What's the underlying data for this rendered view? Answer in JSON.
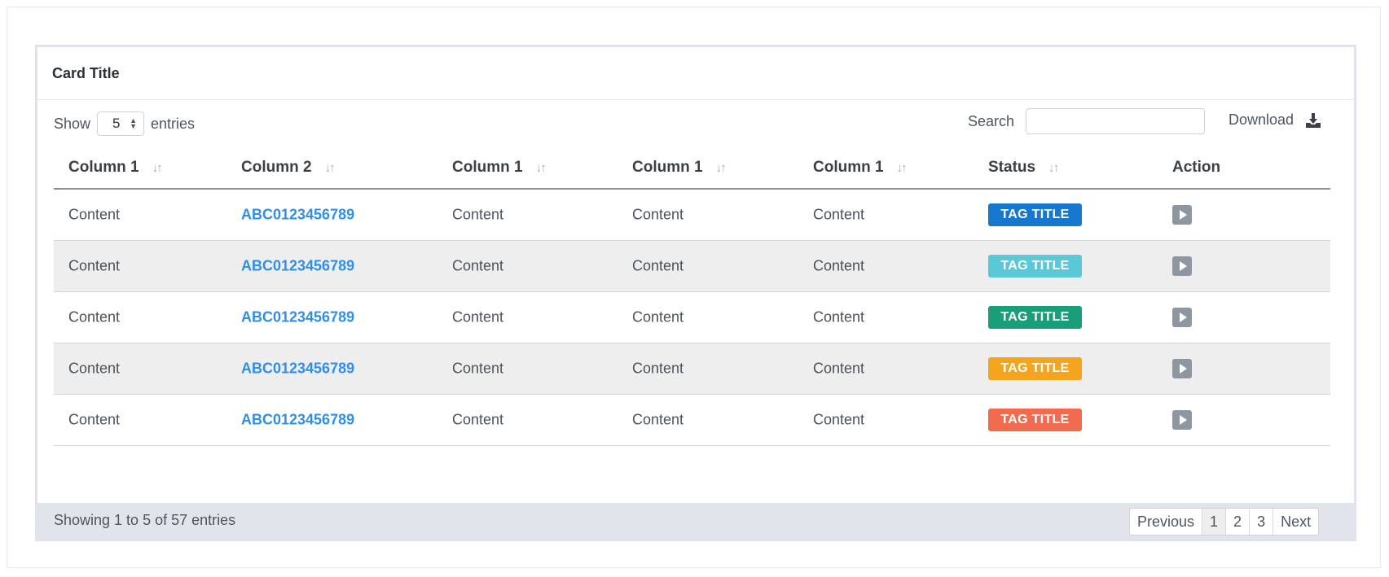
{
  "card": {
    "title": "Card Title"
  },
  "controls": {
    "show_label": "Show",
    "entries_per_page": "5",
    "entries_label": "entries",
    "search_label": "Search",
    "search_value": "",
    "download_label": "Download",
    "download_icon": "download-icon"
  },
  "table": {
    "columns": [
      {
        "label": "Column 1",
        "sortable": true
      },
      {
        "label": "Column 2",
        "sortable": true
      },
      {
        "label": "Column 1",
        "sortable": true
      },
      {
        "label": "Column 1",
        "sortable": true
      },
      {
        "label": "Column 1",
        "sortable": true
      },
      {
        "label": "Status",
        "sortable": true
      },
      {
        "label": "Action",
        "sortable": false
      }
    ],
    "sort_icon": "sort-icon",
    "action_icon": "play-icon",
    "rows": [
      {
        "c1": "Content",
        "c2": "ABC0123456789",
        "c3": "Content",
        "c4": "Content",
        "c5": "Content",
        "tag": "TAG TITLE",
        "tag_color": "#1677cc"
      },
      {
        "c1": "Content",
        "c2": "ABC0123456789",
        "c3": "Content",
        "c4": "Content",
        "c5": "Content",
        "tag": "TAG TITLE",
        "tag_color": "#5bc8d8"
      },
      {
        "c1": "Content",
        "c2": "ABC0123456789",
        "c3": "Content",
        "c4": "Content",
        "c5": "Content",
        "tag": "TAG TITLE",
        "tag_color": "#1a9e7a"
      },
      {
        "c1": "Content",
        "c2": "ABC0123456789",
        "c3": "Content",
        "c4": "Content",
        "c5": "Content",
        "tag": "TAG TITLE",
        "tag_color": "#f5a51d"
      },
      {
        "c1": "Content",
        "c2": "ABC0123456789",
        "c3": "Content",
        "c4": "Content",
        "c5": "Content",
        "tag": "TAG TITLE",
        "tag_color": "#f26b4f"
      }
    ]
  },
  "footer": {
    "info": "Showing 1 to 5 of 57 entries",
    "pagination": {
      "previous": "Previous",
      "pages": [
        "1",
        "2",
        "3"
      ],
      "active_page": "1",
      "next": "Next"
    }
  },
  "colors": {
    "link": "#2f8fe6",
    "striped_row": "#eeeeee",
    "footer_bg": "#e1e5eb"
  }
}
